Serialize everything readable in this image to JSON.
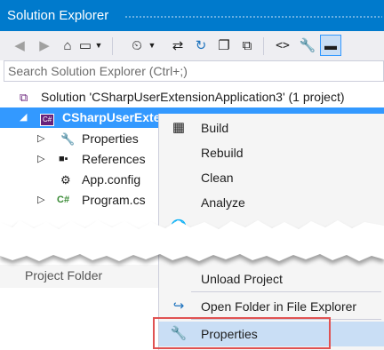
{
  "window": {
    "title": "Solution Explorer"
  },
  "toolbar": {
    "icons": [
      "back-icon",
      "forward-icon",
      "home-icon",
      "dropdown-icon",
      "history-icon",
      "dropdown-icon",
      "sync-icon",
      "refresh-icon",
      "collapse-all-icon",
      "copy-icon",
      "code-icon",
      "wrench-icon",
      "pin-icon"
    ]
  },
  "search": {
    "placeholder": "Search Solution Explorer (Ctrl+;)"
  },
  "tree": {
    "solution": "Solution 'CSharpUserExtensionApplication3' (1 project)",
    "project": "CSharpUserExte",
    "project_icon": "C#",
    "items": [
      {
        "label": "Properties"
      },
      {
        "label": "References"
      },
      {
        "label": "App.config"
      },
      {
        "label": "Program.cs"
      }
    ],
    "project_folder": "Project Folder"
  },
  "context_menu": {
    "items": [
      {
        "label": "Build"
      },
      {
        "label": "Rebuild"
      },
      {
        "label": "Clean"
      },
      {
        "label": "Analyze"
      },
      {
        "label": "Unload Project"
      },
      {
        "label": "Open Folder in File Explorer"
      },
      {
        "label": "Properties"
      }
    ]
  },
  "colors": {
    "titlebar": "#007acc",
    "selection": "#3399ff",
    "menu_highlight": "#c9def5",
    "callout": "#e05252"
  }
}
